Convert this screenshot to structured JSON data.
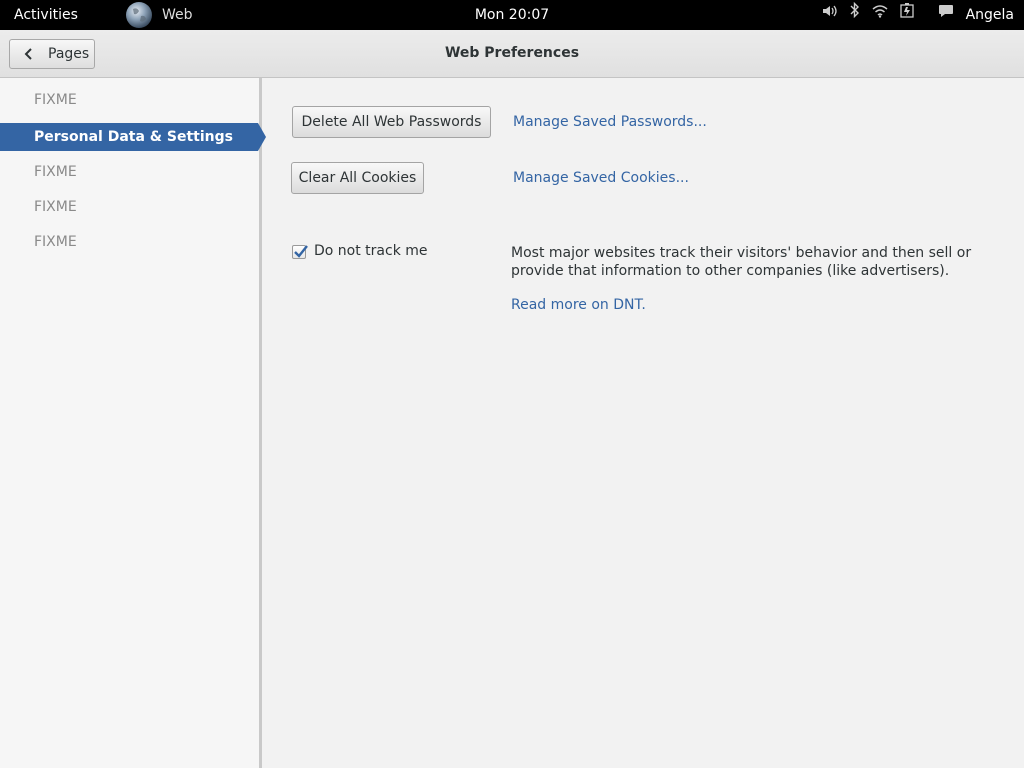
{
  "topbar": {
    "activities": "Activities",
    "app_name": "Web",
    "clock": "Mon 20:07",
    "user": "Angela",
    "icons": [
      "globe-icon",
      "volume-icon",
      "bluetooth-icon",
      "wifi-icon",
      "battery-icon",
      "chat-icon"
    ]
  },
  "header": {
    "back_label": "Pages",
    "title": "Web Preferences"
  },
  "sidebar": {
    "items": [
      {
        "label": "FIXME",
        "active": false
      },
      {
        "label": "Personal Data & Settings",
        "active": true
      },
      {
        "label": "FIXME",
        "active": false
      },
      {
        "label": "FIXME",
        "active": false
      },
      {
        "label": "FIXME",
        "active": false
      }
    ]
  },
  "content": {
    "delete_passwords_label": "Delete All Web Passwords",
    "manage_passwords_link": "Manage Saved Passwords...",
    "clear_cookies_label": "Clear All Cookies",
    "manage_cookies_link": "Manage Saved Cookies...",
    "dnt_label": "Do not track me",
    "dnt_checked": true,
    "dnt_description": "Most major websites track their visitors' behavior and then sell or provide that information to other companies (like advertisers).",
    "dnt_read_more": "Read more on DNT."
  },
  "colors": {
    "accent": "#3465a4",
    "topbar": "#000000"
  }
}
